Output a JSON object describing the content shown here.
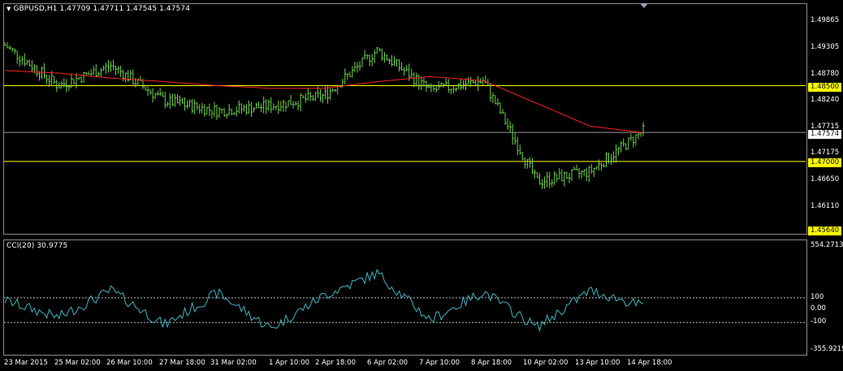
{
  "window": {
    "caption": "GBPUSD,H1  1.47709 1.47711 1.47545 1.47574",
    "indicator_caption": "CCI(20) 30.9775"
  },
  "price_axis": {
    "labels": [
      "1.49865",
      "1.49305",
      "1.48780",
      "1.48240",
      "1.47715",
      "1.47175",
      "1.46650",
      "1.46110",
      "1.45640"
    ],
    "current_price": "1.47574",
    "hline_1": "1.48500",
    "hline_2": "1.47000",
    "low_tag": "1.45640"
  },
  "cci_axis": {
    "labels": [
      "554.2713",
      "100",
      "0.00",
      "-100",
      "-355.9219"
    ]
  },
  "time_axis": {
    "labels": [
      "23 Mar 2015",
      "25 Mar 02:00",
      "26 Mar 10:00",
      "27 Mar 18:00",
      "31 Mar 02:00",
      "1 Apr 10:00",
      "2 Apr 18:00",
      "6 Apr 02:00",
      "7 Apr 10:00",
      "8 Apr 18:00",
      "10 Apr 02:00",
      "13 Apr 10:00",
      "14 Apr 18:00"
    ]
  },
  "colors": {
    "background": "#000000",
    "bars": "#6fd64a",
    "ma": "#ff2020",
    "cci": "#3fb6c2",
    "hline": "#ffff00",
    "grid": "#8c8c8c"
  },
  "chart_data": [
    {
      "type": "line",
      "title": "GBPUSD,H1",
      "x": [
        "23 Mar 2015",
        "25 Mar 02:00",
        "26 Mar 10:00",
        "27 Mar 18:00",
        "31 Mar 02:00",
        "1 Apr 10:00",
        "2 Apr 18:00",
        "6 Apr 02:00",
        "7 Apr 10:00",
        "8 Apr 18:00",
        "10 Apr 02:00",
        "13 Apr 10:00",
        "14 Apr 18:00"
      ],
      "series": [
        {
          "name": "",
          "values": [
            1.493,
            1.485,
            1.489,
            1.482,
            1.48,
            1.481,
            1.483,
            1.492,
            1.484,
            1.486,
            1.466,
            1.468,
            1.476
          ]
        },
        {
          "name": "",
          "values": [
            1.488,
            1.4875,
            1.4865,
            1.4858,
            1.485,
            1.4845,
            1.4845,
            1.4858,
            1.4868,
            1.486,
            1.4815,
            1.477,
            1.4757
          ]
        }
      ],
      "ylim": [
        1.456,
        1.501
      ]
    },
    {
      "type": "line",
      "title": "CCI(20) 30.9775",
      "x": [
        "23 Mar 2015",
        "25 Mar 02:00",
        "26 Mar 10:00",
        "27 Mar 18:00",
        "31 Mar 02:00",
        "1 Apr 10:00",
        "2 Apr 18:00",
        "6 Apr 02:00",
        "7 Apr 10:00",
        "8 Apr 18:00",
        "10 Apr 02:00",
        "13 Apr 10:00",
        "14 Apr 18:00"
      ],
      "series": [
        {
          "name": "",
          "values": [
            80,
            -60,
            160,
            -120,
            140,
            -150,
            120,
            300,
            -80,
            150,
            -140,
            160,
            31
          ]
        }
      ],
      "ylim": [
        -355.9219,
        554.2713
      ]
    }
  ]
}
